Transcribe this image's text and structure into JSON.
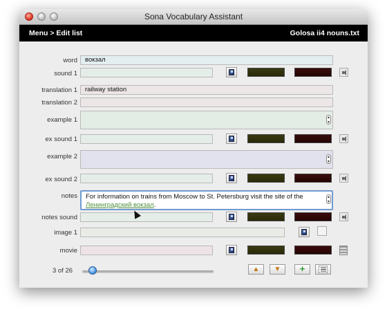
{
  "window": {
    "title": "Sona Vocabulary Assistant"
  },
  "header": {
    "breadcrumb": "Menu > Edit list",
    "list_name": "Golosa ii4 nouns.txt"
  },
  "form": {
    "word": {
      "label": "word",
      "value": "вокзал"
    },
    "sound1": {
      "label": "sound 1"
    },
    "translation1": {
      "label": "translation 1",
      "value": "railway station"
    },
    "translation2": {
      "label": "translation 2",
      "value": ""
    },
    "example1": {
      "label": "example 1",
      "value": ""
    },
    "ex_sound1": {
      "label": "ex sound 1"
    },
    "example2": {
      "label": "example 2",
      "value": ""
    },
    "ex_sound2": {
      "label": "ex sound 2"
    },
    "notes": {
      "label": "notes",
      "text": "For information on trains from Moscow to St. Petersburg visit the site of the",
      "link": "Ленинградский вокзал",
      "after_link": "."
    },
    "notes_sound": {
      "label": "notes sound"
    },
    "image1": {
      "label": "image 1"
    },
    "movie": {
      "label": "movie"
    }
  },
  "footer": {
    "counter": "3 of 26",
    "position_fraction": 0.08,
    "buttons": {
      "up": "▲",
      "down": "▼",
      "add": "+",
      "list": "list"
    }
  },
  "colors": {
    "notes_link": "#4e8f3a",
    "slider_knob": "#3a8de0",
    "add_button": "#2f9a2f",
    "arrow_buttons": "#c07a10"
  },
  "icons": [
    "save-disk-icon",
    "speaker-icon",
    "film-strip-icon",
    "list-icon",
    "arrow-up-icon",
    "arrow-down-icon",
    "plus-icon",
    "stepper-icon"
  ]
}
